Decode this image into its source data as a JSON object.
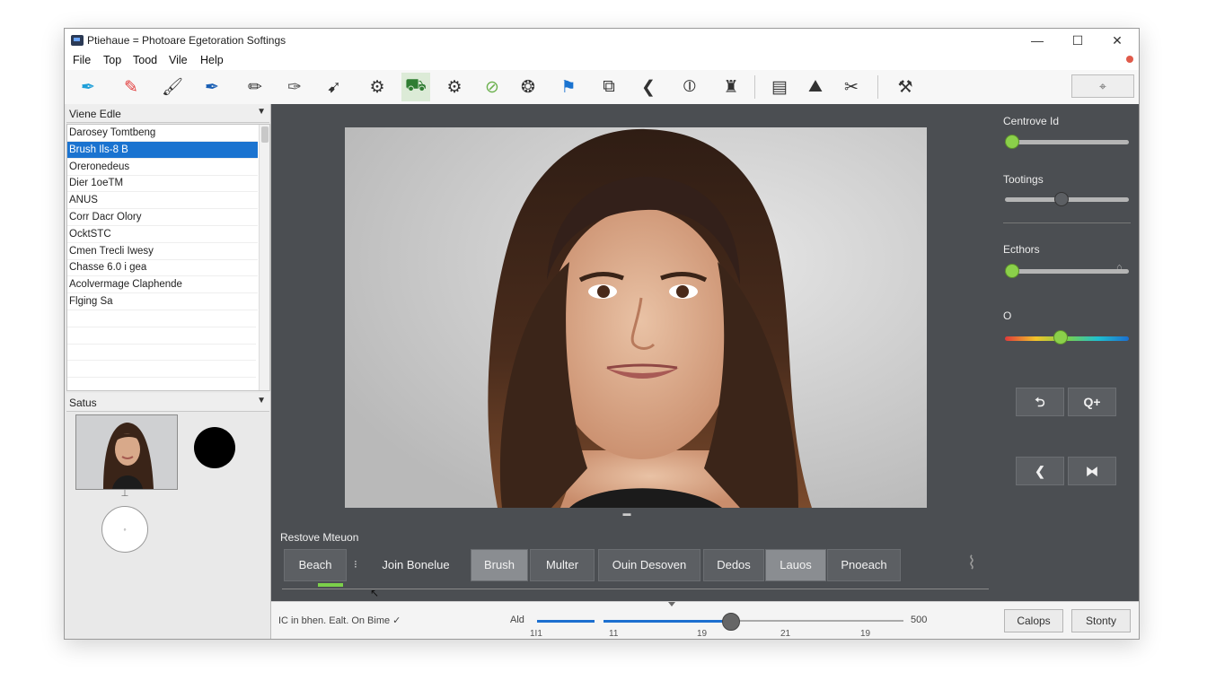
{
  "window": {
    "title": "Ptiehaue = Photoare Egetoration Softings",
    "controls": [
      "—",
      "☐",
      "✕"
    ]
  },
  "menu": [
    "File",
    "Top",
    "Tood",
    "Vile",
    "Help"
  ],
  "toolbar": {
    "tools": [
      {
        "name": "pen-blue-icon",
        "glyph": "✒",
        "color": "#1f9fd8"
      },
      {
        "name": "eraser-icon",
        "glyph": "✎",
        "color": "#e23b3b"
      },
      {
        "name": "brush-icon",
        "glyph": "🖌",
        "color": "#333333"
      },
      {
        "name": "pen-icon",
        "glyph": "✒",
        "color": "#1a5fb4"
      },
      {
        "name": "pencil-icon",
        "glyph": "✏",
        "color": "#333333"
      },
      {
        "name": "feather-icon",
        "glyph": "✑",
        "color": "#555555"
      },
      {
        "name": "knife-icon",
        "glyph": "➹",
        "color": "#333333"
      },
      {
        "name": "gear-brush-icon",
        "glyph": "⚙",
        "color": "#333333"
      },
      {
        "name": "car-brush-icon",
        "glyph": "⛟",
        "color": "#2f7d32"
      },
      {
        "name": "circle-gear-icon",
        "glyph": "⚙",
        "color": "#333333"
      },
      {
        "name": "leaf-icon",
        "glyph": "⊘",
        "color": "#6ab04c"
      },
      {
        "name": "spiral-icon",
        "glyph": "❂",
        "color": "#333333"
      },
      {
        "name": "flag-icon",
        "glyph": "⚑",
        "color": "#1a73d0"
      },
      {
        "name": "crop-icon",
        "glyph": "⧉",
        "color": "#333333"
      },
      {
        "name": "chevron-left-icon",
        "glyph": "❮",
        "color": "#333333"
      },
      {
        "name": "split-icon",
        "glyph": "⦶",
        "color": "#333333"
      },
      {
        "name": "stamp-icon",
        "glyph": "♜",
        "color": "#333333"
      },
      {
        "name": "tray-icon",
        "glyph": "▤",
        "color": "#333333"
      },
      {
        "name": "mask-icon",
        "glyph": "⛰",
        "color": "#333333"
      },
      {
        "name": "tools-icon",
        "glyph": "✂",
        "color": "#333333"
      },
      {
        "name": "eyedropper-icon",
        "glyph": "⚒",
        "color": "#333333"
      }
    ],
    "active_tool_index": 8,
    "right_button": "⌖"
  },
  "left_panel": {
    "view_combo": "Viene Edle",
    "items": [
      "Darosey Tomtbeng",
      "Brush Ils-8 B",
      "Oreronedeus",
      "Dier 1oeTM",
      "ANUS",
      "Corr Dacr Olory",
      "OcktSTC",
      "Cmen Trecli Iwesy",
      "Chasse 6.0 i gea",
      "Acolvermage Claphende",
      "Flging Sa"
    ],
    "selected_index": 1,
    "status_combo": "Satus"
  },
  "right_panel": {
    "sliders": [
      {
        "label": "Centrove Id",
        "value": 0.0,
        "knob": "green"
      },
      {
        "label": "Tootings",
        "value": 0.45,
        "knob": "gray"
      },
      {
        "label": "Ecthors",
        "value": 0.0,
        "knob": "green"
      },
      {
        "label": "O",
        "value": 0.45,
        "knob": "green",
        "gradient": true
      }
    ],
    "buttons": [
      {
        "name": "undo-button",
        "label": "⮌"
      },
      {
        "name": "zoom-in-button",
        "label": "Q+"
      },
      {
        "name": "prev-button",
        "label": "❮"
      },
      {
        "name": "split-button",
        "label": "⧓"
      }
    ]
  },
  "bottom": {
    "section_label": "Restove Mteuon",
    "tabs": [
      {
        "label": "Beach",
        "active": false
      },
      {
        "label": "Join Bonelue",
        "active": false
      },
      {
        "label": "Brush",
        "active": true
      },
      {
        "label": "Multer",
        "active": false
      },
      {
        "label": "Ouin Desoven",
        "active": false
      },
      {
        "label": "Dedos",
        "active": false
      },
      {
        "label": "Lauos",
        "active": true
      },
      {
        "label": "Pnoeach",
        "active": false
      }
    ],
    "tab_separator": "⁝",
    "corner_icon": "⌇"
  },
  "status": {
    "text": "IC in bhen. Ealt. On Bime ✓",
    "slider_label": "Ald",
    "slider_max": "500",
    "slider_value": 0.35,
    "ticks": [
      "1I1",
      "11",
      "19",
      "21",
      "19"
    ],
    "buttons": [
      "Calops",
      "Stonty"
    ]
  },
  "colors": {
    "accent_blue": "#1a73d0",
    "accent_green": "#8bd04a",
    "panel_dark": "#4b4e52"
  }
}
